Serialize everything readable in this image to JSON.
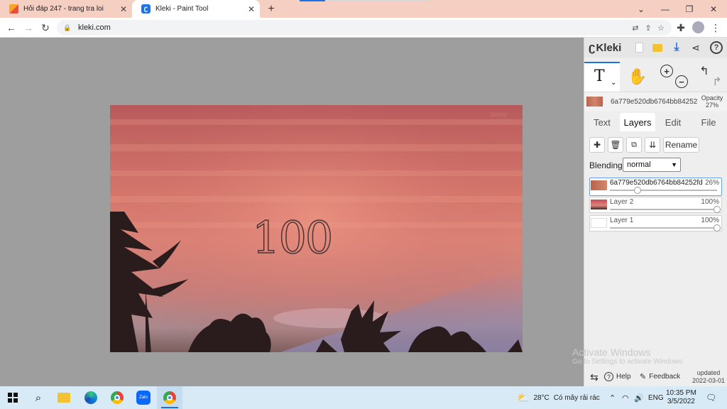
{
  "browser": {
    "tabs": [
      {
        "title": "Hỏi đáp 247 - trang tra loi",
        "favicon": "hoidap-favicon"
      },
      {
        "title": "Kleki - Paint Tool",
        "favicon": "kleki-favicon"
      }
    ],
    "new_tab": "+",
    "url": "kleki.com"
  },
  "canvas": {
    "overlay_number": "100",
    "watermark_line1": "zenny",
    "watermark_line2": "#hd247"
  },
  "kleki": {
    "logo": "Kleki",
    "current_layer_name": "6a779e520db6764bb84252",
    "opacity_label": "Opacity",
    "opacity_value": "27%",
    "tabs": [
      "Text",
      "Layers",
      "Edit",
      "File"
    ],
    "active_tab": "Layers",
    "rename_label": "Rename",
    "blending_label": "Blending",
    "blending_value": "normal",
    "layers": [
      {
        "name": "6a779e520db6764bb84252fd",
        "opacity": "26%",
        "opacity_value": 0.26
      },
      {
        "name": "Layer 2",
        "opacity": "100%",
        "opacity_value": 1.0
      },
      {
        "name": "Layer 1",
        "opacity": "100%",
        "opacity_value": 1.0
      }
    ],
    "help_label": "Help",
    "feedback_label": "Feedback",
    "updated_label": "updated",
    "updated_date": "2022-03-01"
  },
  "activation": {
    "title": "Activate Windows",
    "subtitle": "Go to Settings to activate Windows."
  },
  "taskbar": {
    "weather_temp": "28°C",
    "weather_text": "Có mây rải rác",
    "language": "ENG",
    "time": "10:35 PM",
    "date": "3/5/2022"
  },
  "colors": {
    "tab_strip": "#f6cfc3",
    "canvas_bg": "#9e9e9e",
    "accent": "#1a73e8",
    "taskbar": "#d8eaf6"
  }
}
